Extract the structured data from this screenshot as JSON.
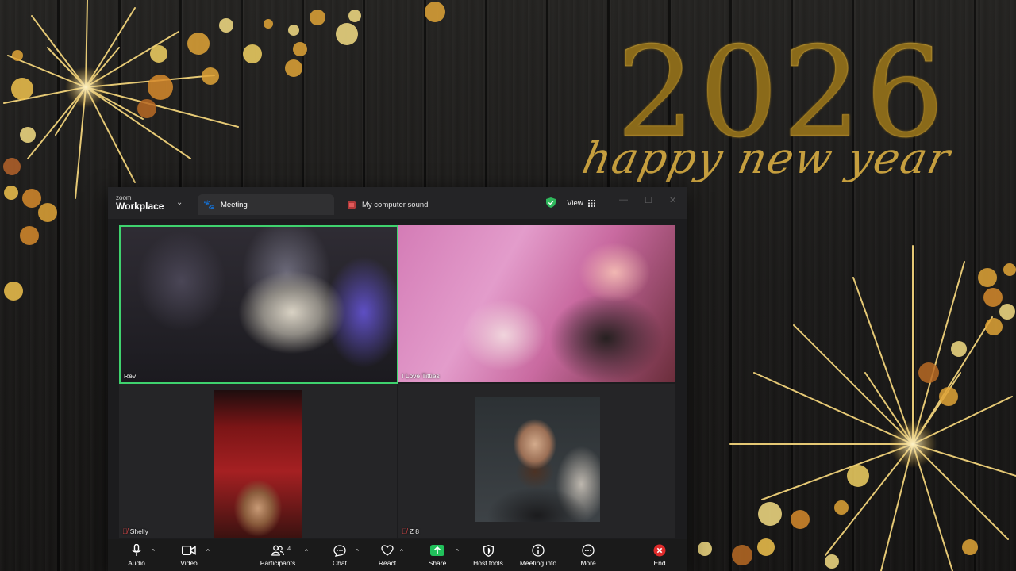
{
  "desktop": {
    "year": "2026",
    "greeting": "happy new year"
  },
  "window": {
    "brand_small": "zoom",
    "brand_big": "Workplace",
    "meeting_tab": "Meeting",
    "sound_tab": "My computer sound",
    "view_label": "View"
  },
  "participants": [
    {
      "name": "Rev",
      "muted": false,
      "active_speaker": true
    },
    {
      "name": "I Love Titties",
      "muted": false,
      "active_speaker": false
    },
    {
      "name": "Shelly",
      "muted": true,
      "active_speaker": false
    },
    {
      "name": "Z 8",
      "muted": true,
      "active_speaker": false
    }
  ],
  "toolbar": {
    "audio": "Audio",
    "video": "Video",
    "participants": "Participants",
    "participants_count": "4",
    "chat": "Chat",
    "react": "React",
    "share": "Share",
    "host_tools": "Host tools",
    "meeting_info": "Meeting info",
    "more": "More",
    "end": "End"
  },
  "colors": {
    "active_speaker_border": "#3fd26e",
    "share_green": "#21c15b",
    "end_red": "#e02b2b",
    "gold": "#c9a23a"
  }
}
